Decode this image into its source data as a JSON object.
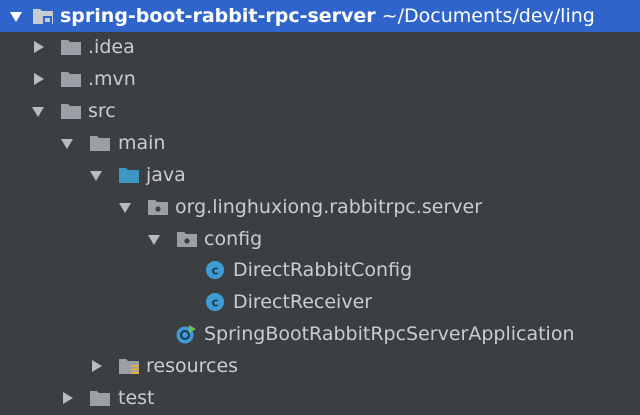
{
  "colors": {
    "background": "#3c3f41",
    "selection": "#2f65ca",
    "folder_gray": "#9aa0a6",
    "folder_source": "#3c97c2",
    "class_icon": "#3f9bd4"
  },
  "tree": {
    "root": {
      "name": "spring-boot-rabbit-rpc-server",
      "path": "~/Documents/dev/ling",
      "icon": "module-folder-icon"
    },
    "items": [
      {
        "label": ".idea",
        "icon": "folder-icon",
        "state": "collapsed"
      },
      {
        "label": ".mvn",
        "icon": "folder-icon",
        "state": "collapsed"
      },
      {
        "label": "src",
        "icon": "folder-icon",
        "state": "expanded"
      },
      {
        "label": "main",
        "icon": "folder-icon",
        "state": "expanded"
      },
      {
        "label": "java",
        "icon": "source-folder-icon",
        "state": "expanded"
      },
      {
        "label": "org.linghuxiong.rabbitrpc.server",
        "icon": "package-icon",
        "state": "expanded"
      },
      {
        "label": "config",
        "icon": "package-icon",
        "state": "expanded"
      },
      {
        "label": "DirectRabbitConfig",
        "icon": "class-icon",
        "state": "leaf"
      },
      {
        "label": "DirectReceiver",
        "icon": "class-icon",
        "state": "leaf"
      },
      {
        "label": "SpringBootRabbitRpcServerApplication",
        "icon": "spring-boot-class-icon",
        "state": "leaf"
      },
      {
        "label": "resources",
        "icon": "resources-folder-icon",
        "state": "collapsed"
      },
      {
        "label": "test",
        "icon": "folder-icon",
        "state": "collapsed"
      }
    ]
  }
}
